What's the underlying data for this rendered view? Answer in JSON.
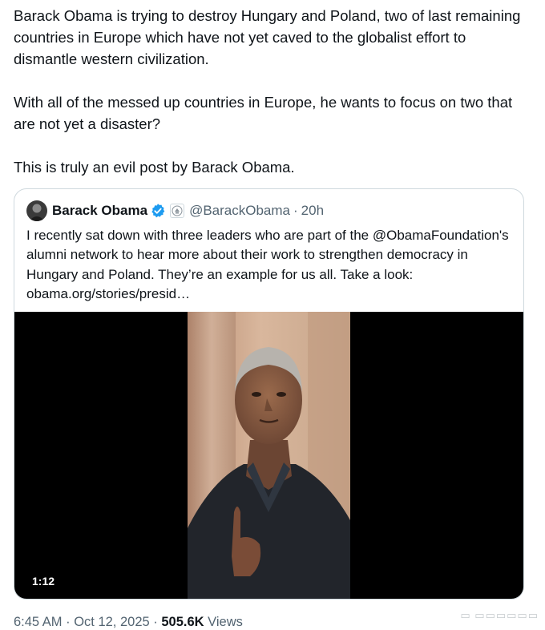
{
  "tweet": {
    "paragraphs": [
      "Barack Obama is trying to destroy Hungary and Poland, two of last remaining countries in Europe which have not yet caved to the globalist effort to dismantle western civilization.",
      "With all of the messed up countries in Europe, he wants to focus on two that are not yet a disaster?",
      "This is truly an evil post by Barack Obama."
    ],
    "timestamp": "6:45 AM · Oct 12, 2025 · ",
    "views_count": "505.6K",
    "views_label": " Views"
  },
  "quote": {
    "author_name": "Barack Obama",
    "handle": "@BarackObama",
    "separator": "·",
    "time": "20h",
    "text": "I recently sat down with three leaders who are part of the @ObamaFoundation's alumni network to hear more about their work to strengthen democracy in Hungary and Poland. They’re an example for us all. Take a look: obama.org/stories/presid…",
    "video_duration": "1:12"
  },
  "colors": {
    "text": "#0f1419",
    "secondary": "#536471",
    "verified": "#1d9bf0",
    "border": "#cfd9de"
  },
  "icons": [
    "verified-badge-icon",
    "government-seal-icon"
  ]
}
